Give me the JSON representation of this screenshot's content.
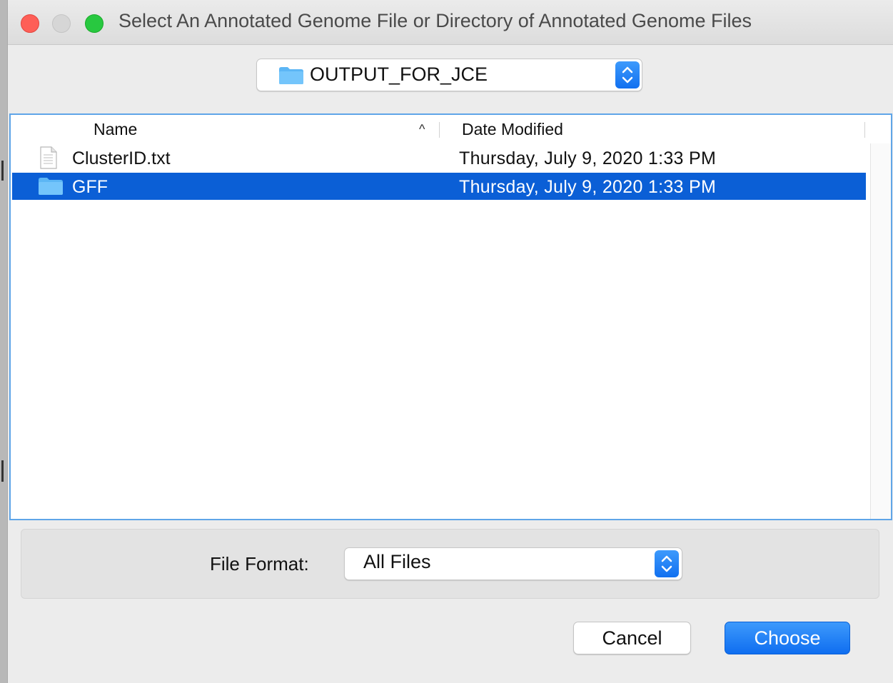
{
  "window": {
    "title": "Select An Annotated Genome File or Directory of Annotated Genome Files"
  },
  "location": {
    "folder_icon": "folder-icon",
    "current": "OUTPUT_FOR_JCE"
  },
  "file_list": {
    "columns": [
      "Name",
      "Date Modified"
    ],
    "sort_indicator": "^",
    "rows": [
      {
        "name": "ClusterID.txt",
        "date": "Thursday, July 9, 2020 1:33 PM",
        "icon": "text-file-icon",
        "selected": false
      },
      {
        "name": "GFF",
        "date": "Thursday, July 9, 2020 1:33 PM",
        "icon": "folder-icon",
        "selected": true
      }
    ]
  },
  "format": {
    "label": "File Format:",
    "selected": "All Files"
  },
  "buttons": {
    "cancel": "Cancel",
    "choose": "Choose"
  },
  "colors": {
    "selection": "#0b5fd6",
    "accent": "#1170f0",
    "focus_ring": "#5fa5e8"
  }
}
